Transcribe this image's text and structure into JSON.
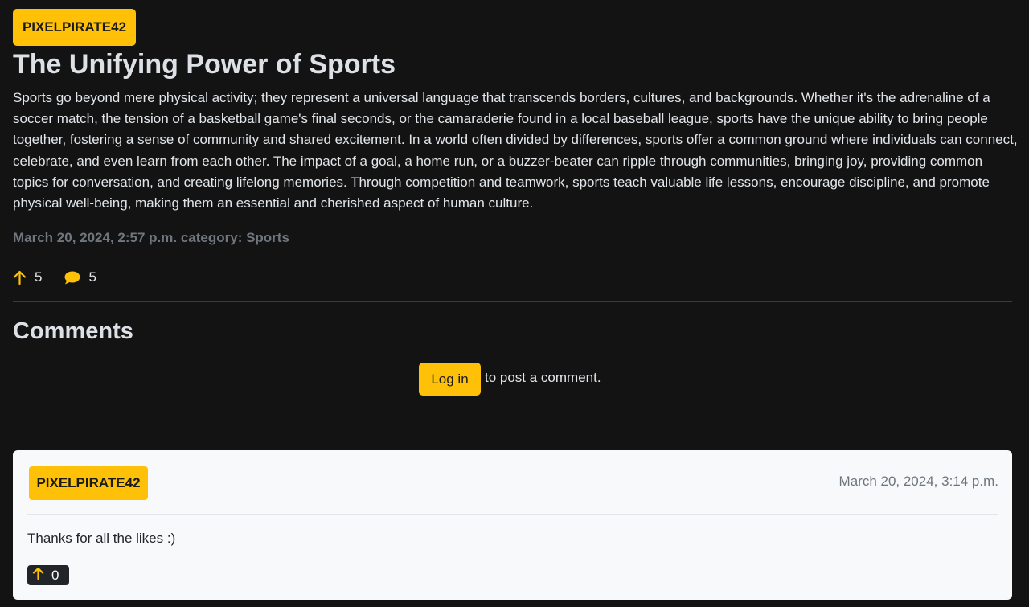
{
  "post": {
    "author": "PIXELPIRATE42",
    "title": "The Unifying Power of Sports",
    "body": "Sports go beyond mere physical activity; they represent a universal language that transcends borders, cultures, and backgrounds. Whether it's the adrenaline of a soccer match, the tension of a basketball game's final seconds, or the camaraderie found in a local baseball league, sports have the unique ability to bring people together, fostering a sense of community and shared excitement. In a world often divided by differences, sports offer a common ground where individuals can connect, celebrate, and even learn from each other. The impact of a goal, a home run, or a buzzer-beater can ripple through communities, bringing joy, providing common topics for conversation, and creating lifelong memories. Through competition and teamwork, sports teach valuable life lessons, encourage discipline, and promote physical well-being, making them an essential and cherished aspect of human culture.",
    "meta": "March 20, 2024, 2:57 p.m. category: Sports",
    "upvotes": "5",
    "comment_count": "5",
    "icons": {
      "upvote": "arrow-up-icon",
      "comment": "speech-bubble-icon"
    }
  },
  "comments_section": {
    "heading": "Comments",
    "login_label": "Log in",
    "login_suffix": "to post a comment."
  },
  "comments": [
    {
      "author": "PIXELPIRATE42",
      "date": "March 20, 2024, 3:14 p.m.",
      "text": "Thanks for all the likes :)",
      "likes": "0"
    }
  ],
  "colors": {
    "accent": "#ffc107",
    "background": "#131313",
    "card": "#f8f9fa",
    "muted": "#6f767d"
  }
}
